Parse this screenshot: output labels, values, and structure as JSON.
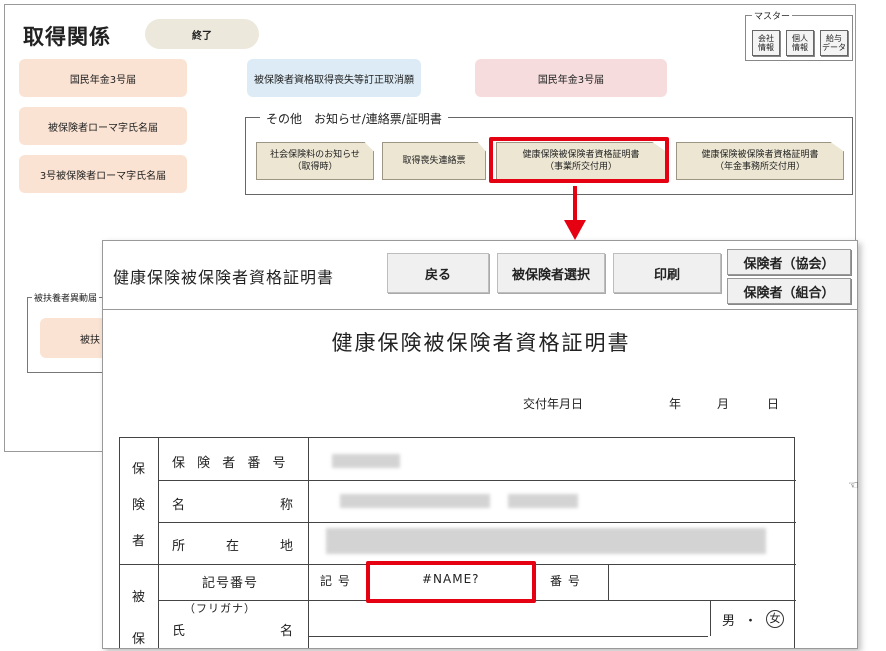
{
  "background_window": {
    "title": "取得関係",
    "end_button": "終了",
    "master": {
      "title": "マスター",
      "buttons": [
        "会社\n情報",
        "個人\n情報",
        "給与\nデータ"
      ]
    },
    "left_buttons": [
      "国民年金3号届",
      "被保険者ローマ字氏名届",
      "3号被保険者ローマ字氏名届"
    ],
    "top_center_button": "被保険者資格取得喪失等訂正取消願",
    "top_right_button": "国民年金3号届",
    "others_group": {
      "title": "その他　お知らせ/連絡票/証明書",
      "buttons": [
        "社会保険料のお知らせ\n（取得時）",
        "取得喪失連絡票",
        "健康保険被保険者資格証明書\n（事業所交付用）",
        "健康保険被保険者資格証明書\n（年金事務所交付用）"
      ]
    },
    "dependent_group": {
      "title": "被扶養者異動届",
      "button": "被扶"
    }
  },
  "foreground_window": {
    "title": "健康保険被保険者資格証明書",
    "toolbar": {
      "back": "戻る",
      "select_insured": "被保険者選択",
      "print": "印刷",
      "insurer_kyokai": "保険者（協会）",
      "insurer_kumiai": "保険者（組合）"
    },
    "document": {
      "heading": "健康保険被保険者資格証明書",
      "issue_date_label": "交付年月日",
      "year": "年",
      "month": "月",
      "day": "日",
      "insurer_side": [
        "保",
        "険",
        "者"
      ],
      "insurer_rows": [
        "保 険 者 番 号",
        "名",
        "称",
        "所",
        "在",
        "地"
      ],
      "insured_side": [
        "被",
        "保"
      ],
      "symbol_number_label": "記号番号",
      "symbol_label": "記 号",
      "symbol_value": "#NAME?",
      "number_label": "番 号",
      "furigana_label": "（フリガナ）",
      "name_label_1": "氏",
      "name_label_2": "名",
      "gender_male": "男",
      "gender_dot": "・",
      "gender_female": "女"
    }
  },
  "colors": {
    "highlight": "#e50012",
    "peach": "#fbe3d3",
    "light_blue": "#dcebf5",
    "pink": "#f6dcdc",
    "doc_button": "#ece6d3"
  }
}
